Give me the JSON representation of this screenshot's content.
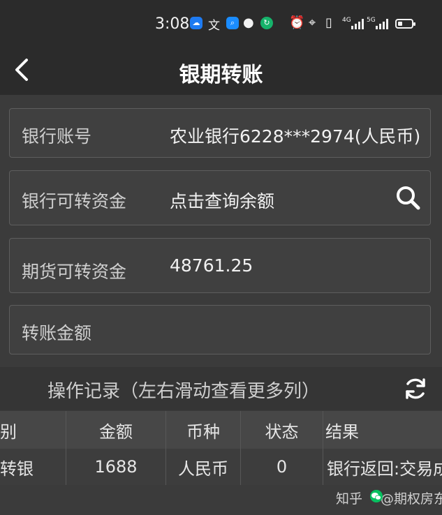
{
  "status_bar": {
    "time": "3:08",
    "network_label_1": "4G",
    "network_label_2": "5G",
    "icons": [
      "weather-app-icon",
      "translate-icon",
      "search-app-icon",
      "chat-bubble-icon",
      "green-app-icon",
      "alarm-icon",
      "location-icon",
      "vibrate-icon",
      "signal-icon",
      "signal-icon",
      "battery-icon"
    ],
    "battery_level": 0.35
  },
  "header": {
    "title": "银期转账",
    "back_icon": "chevron-left-icon"
  },
  "form": {
    "bank_account": {
      "label": "银行账号",
      "value": "农业银行6228***2974(人民币)"
    },
    "bank_available": {
      "label": "银行可转资金",
      "value": "点击查询余额",
      "icon": "search-icon"
    },
    "futures_available": {
      "label": "期货可转资金",
      "value": "48761.25"
    },
    "transfer_amount": {
      "label": "转账金额",
      "value": ""
    }
  },
  "records": {
    "title": "操作记录（左右滑动查看更多列）",
    "refresh_icon": "refresh-icon",
    "columns": [
      "类别",
      "金额",
      "币种",
      "状态",
      "结果"
    ],
    "rows": [
      [
        "期转银",
        "1688",
        "人民币",
        "0",
        "银行返回:交易成功"
      ]
    ]
  },
  "watermark": {
    "text_1": "知乎",
    "text_2": "@期权房东"
  },
  "colors": {
    "background": "#3b3b3b",
    "bar": "#2b2b2b",
    "field_bg": "#404040",
    "field_border": "#5e5e5e",
    "text": "#e6e6e6",
    "wechat_green": "#07c160"
  }
}
